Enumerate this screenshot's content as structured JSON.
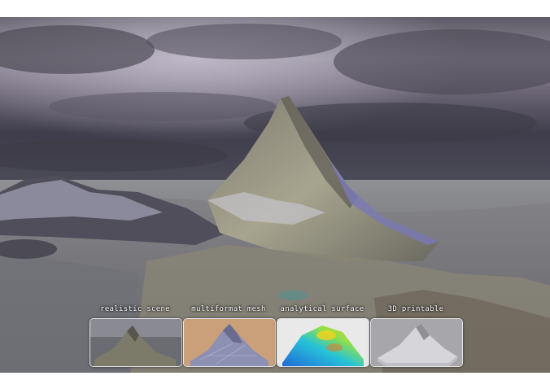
{
  "gallery": {
    "items": [
      {
        "label": "realistic scene",
        "icon": "mountain-scene-thumbnail"
      },
      {
        "label": "multiformat mesh",
        "icon": "mountain-mesh-thumbnail"
      },
      {
        "label": "analytical surface",
        "icon": "heatmap-surface-thumbnail"
      },
      {
        "label": "3D printable",
        "icon": "printable-model-thumbnail"
      }
    ]
  },
  "colors": {
    "sky_dark": "#4a4853",
    "sky_light": "#b8b3c0",
    "rock": "#8b8a7c",
    "snow": "#c9c9d6",
    "heatmap_low": "#1d6fe0",
    "heatmap_high": "#f0d020"
  }
}
